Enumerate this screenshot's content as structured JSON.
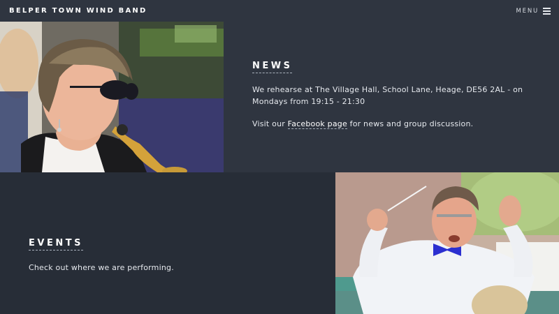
{
  "header": {
    "brand": "BELPER TOWN WIND BAND",
    "menu_label": "MENU"
  },
  "news": {
    "heading": "NEWS",
    "paragraph1": "We rehearse at The Village Hall, School Lane, Heage, DE56 2AL - on Mondays from 19:15 - 21:30",
    "paragraph2_prefix": "Visit our ",
    "paragraph2_link": "Facebook page",
    "paragraph2_suffix": " for news and group discussion."
  },
  "events": {
    "heading": "EVENTS",
    "paragraph1": "Check out where we are performing."
  },
  "colors": {
    "header_bg": "#2f3540",
    "top_section_bg": "#2f3540",
    "bottom_section_bg": "#272d37",
    "text": "#e6e9ee"
  },
  "icons": {
    "menu": "hamburger-icon"
  }
}
